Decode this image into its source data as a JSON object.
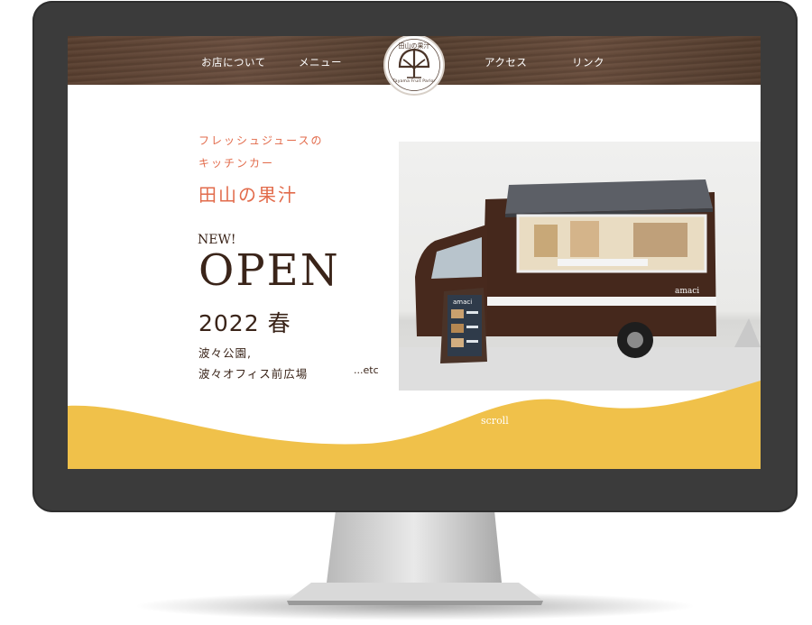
{
  "nav": {
    "items": [
      "お店について",
      "メニュー",
      "アクセス",
      "リンク"
    ]
  },
  "logo": {
    "title": "田山の果汁",
    "subtitle": "Tayama Fruit Parlor"
  },
  "hero": {
    "kicker_line1": "フレッシュジュースの",
    "kicker_line2": "キッチンカー",
    "brand": "田山の果汁",
    "badge": "NEW!",
    "headline": "OPEN",
    "season": "2022 春",
    "location_line1": "波々公園,",
    "location_line2": "波々オフィス前広場",
    "etc": "...etc"
  },
  "photo": {
    "truck_name": "amaci",
    "sign_name": "amaci"
  },
  "scroll_label": "scroll",
  "colors": {
    "accent": "#e26b4b",
    "text_dark": "#3a2419",
    "wave_yellow": "#f0c14a",
    "truck_brown": "#45281c",
    "header_wood": "#5e4333"
  }
}
